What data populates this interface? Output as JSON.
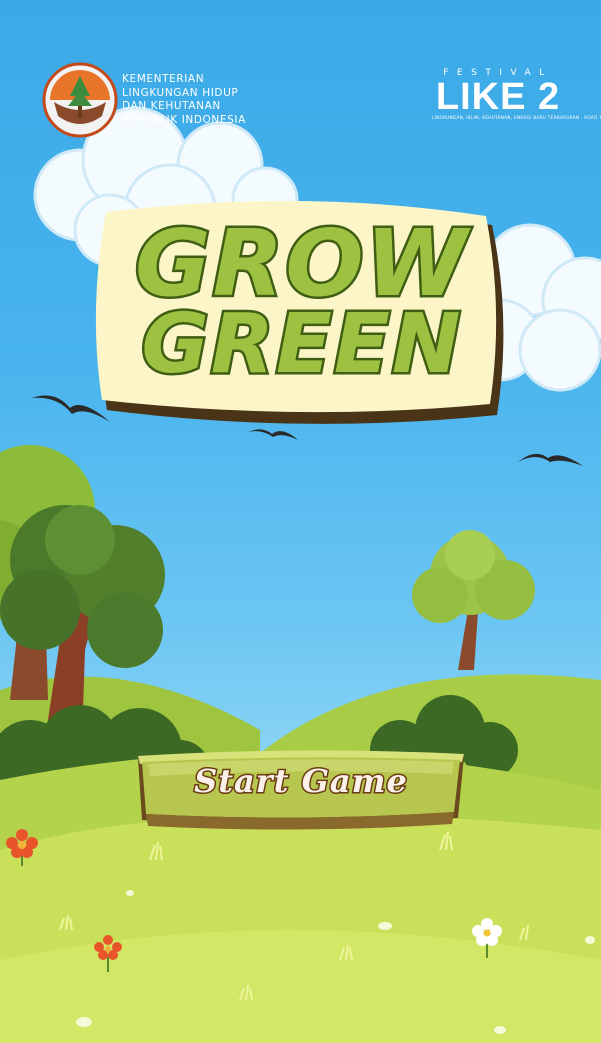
{
  "header": {
    "ministry_lines": [
      "KEMENTERIAN",
      "LINGKUNGAN HIDUP",
      "DAN KEHUTANAN",
      "REPUBLIK INDONESIA"
    ],
    "festival_label": "FESTIVAL",
    "festival_name": "LIKE 2",
    "festival_tagline": "LINGKUNGAN, IKLIM, KEHUTANAN, ENERGI BARU TERBARUKAN · ROAD TO UNFCCC COP29 · 2024"
  },
  "title": {
    "line1": "GROW",
    "line2": "GREEN"
  },
  "start_button": {
    "label": "Start Game"
  },
  "colors": {
    "sky": "#49b4ee",
    "hill_light": "#c9e05a",
    "title_fill": "#9dc140",
    "title_outline": "#3f5e14",
    "button_fill": "#b7c64f",
    "button_border": "#6b4a1e"
  },
  "icons": [
    "ministry-emblem-icon",
    "bird-icon",
    "tree-icon",
    "flower-icon"
  ]
}
